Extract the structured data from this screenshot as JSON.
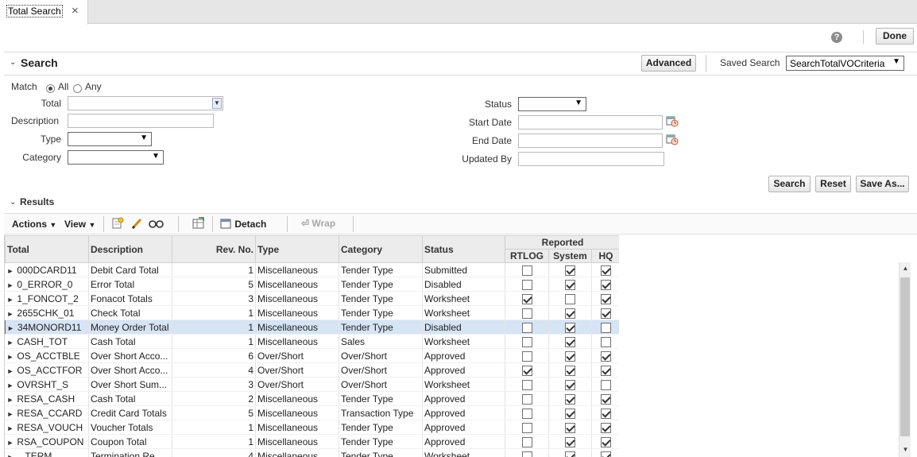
{
  "tab": {
    "label": "Total Search",
    "close": "×"
  },
  "header": {
    "help": "?",
    "done_label": "Done"
  },
  "search": {
    "title": "Search",
    "advanced_label": "Advanced",
    "saved_search_label": "Saved Search",
    "saved_search_value": "SearchTotalVOCriteria",
    "match_label": "Match",
    "match_all": "All",
    "match_any": "Any",
    "fields": {
      "total": "Total",
      "description": "Description",
      "type": "Type",
      "category": "Category",
      "status": "Status",
      "start_date": "Start Date",
      "end_date": "End Date",
      "updated_by": "Updated By"
    },
    "buttons": {
      "search": "Search",
      "reset": "Reset",
      "save_as": "Save As..."
    }
  },
  "results": {
    "title": "Results",
    "toolbar": {
      "actions": "Actions",
      "view": "View",
      "detach": "Detach",
      "wrap": "Wrap"
    },
    "columns": {
      "total": "Total",
      "description": "Description",
      "rev_no": "Rev. No.",
      "type": "Type",
      "category": "Category",
      "status": "Status",
      "reported": "Reported",
      "rtlog": "RTLOG",
      "system": "System",
      "hq": "HQ"
    },
    "rows": [
      {
        "total": "000DCARD11",
        "description": "Debit Card Total",
        "rev": "1",
        "type": "Miscellaneous",
        "category": "Tender Type",
        "status": "Submitted",
        "rtlog": false,
        "system": true,
        "hq": true
      },
      {
        "total": "0_ERROR_0",
        "description": "Error Total",
        "rev": "5",
        "type": "Miscellaneous",
        "category": "Tender Type",
        "status": "Disabled",
        "rtlog": false,
        "system": true,
        "hq": true
      },
      {
        "total": "1_FONCOT_2",
        "description": "Fonacot Totals",
        "rev": "3",
        "type": "Miscellaneous",
        "category": "Tender Type",
        "status": "Worksheet",
        "rtlog": true,
        "system": false,
        "hq": true
      },
      {
        "total": "2655CHK_01",
        "description": "Check Total",
        "rev": "1",
        "type": "Miscellaneous",
        "category": "Tender Type",
        "status": "Worksheet",
        "rtlog": false,
        "system": true,
        "hq": true
      },
      {
        "total": "34MONORD11",
        "description": "Money Order Total",
        "rev": "1",
        "type": "Miscellaneous",
        "category": "Tender Type",
        "status": "Disabled",
        "rtlog": false,
        "system": true,
        "hq": false
      },
      {
        "total": "CASH_TOT",
        "description": "Cash Total",
        "rev": "1",
        "type": "Miscellaneous",
        "category": "Sales",
        "status": "Worksheet",
        "rtlog": false,
        "system": true,
        "hq": false
      },
      {
        "total": "OS_ACCTBLE",
        "description": "Over Short Acco...",
        "rev": "6",
        "type": "Over/Short",
        "category": "Over/Short",
        "status": "Approved",
        "rtlog": false,
        "system": true,
        "hq": true
      },
      {
        "total": "OS_ACCTFOR",
        "description": "Over Short Acco...",
        "rev": "4",
        "type": "Over/Short",
        "category": "Over/Short",
        "status": "Approved",
        "rtlog": true,
        "system": true,
        "hq": true
      },
      {
        "total": "OVRSHT_S",
        "description": "Over Short Sum...",
        "rev": "3",
        "type": "Over/Short",
        "category": "Over/Short",
        "status": "Worksheet",
        "rtlog": false,
        "system": true,
        "hq": false
      },
      {
        "total": "RESA_CASH",
        "description": "Cash Total",
        "rev": "2",
        "type": "Miscellaneous",
        "category": "Tender Type",
        "status": "Approved",
        "rtlog": false,
        "system": true,
        "hq": true
      },
      {
        "total": "RESA_CCARD",
        "description": "Credit Card Totals",
        "rev": "5",
        "type": "Miscellaneous",
        "category": "Transaction Type",
        "status": "Approved",
        "rtlog": false,
        "system": true,
        "hq": true
      },
      {
        "total": "RESA_VOUCH",
        "description": "Voucher Totals",
        "rev": "1",
        "type": "Miscellaneous",
        "category": "Tender Type",
        "status": "Approved",
        "rtlog": false,
        "system": true,
        "hq": true
      },
      {
        "total": "RSA_COUPON",
        "description": "Coupon Total",
        "rev": "1",
        "type": "Miscellaneous",
        "category": "Tender Type",
        "status": "Approved",
        "rtlog": false,
        "system": true,
        "hq": true
      },
      {
        "total": "...TERM",
        "description": "Termination Re...",
        "rev": "4",
        "type": "Miscellaneous",
        "category": "Tender Type",
        "status": "Worksheet",
        "rtlog": false,
        "system": true,
        "hq": true
      }
    ],
    "selected_row": 4
  }
}
